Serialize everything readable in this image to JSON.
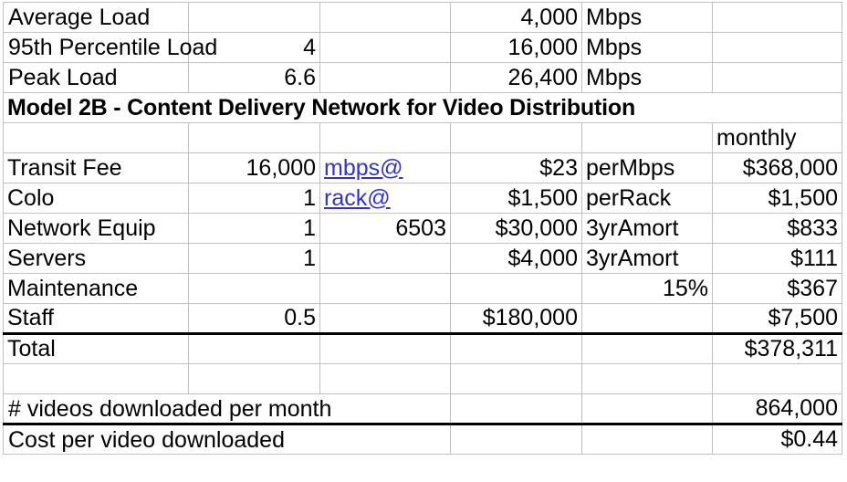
{
  "sheet": {
    "title_row": "Model 2B - Content Delivery Network for Video Distribution",
    "columns": [
      "A",
      "B",
      "C",
      "D",
      "E",
      "F"
    ],
    "rows": [
      {
        "name": "average-load",
        "label": "Average Load",
        "qty": "",
        "unit_link": "",
        "rate": "4,000",
        "basis": "Mbps",
        "monthly": ""
      },
      {
        "name": "95th-percentile-load",
        "label": "95th Percentile Load",
        "qty": "4",
        "unit_link": "",
        "rate": "16,000",
        "basis": "Mbps",
        "monthly": ""
      },
      {
        "name": "peak-load",
        "label": "Peak Load",
        "qty": "6.6",
        "unit_link": "",
        "rate": "26,400",
        "basis": "Mbps",
        "monthly": ""
      },
      {
        "name": "header-monthly",
        "label": "",
        "qty": "",
        "unit_link": "",
        "rate": "",
        "basis": "",
        "monthly": "monthly"
      },
      {
        "name": "transit-fee",
        "label": "Transit Fee",
        "qty": "16,000",
        "unit_link": "mbps@",
        "rate": "$23",
        "basis": "perMbps",
        "monthly": "$368,000"
      },
      {
        "name": "colo",
        "label": "Colo",
        "qty": "1",
        "unit_link": "rack@",
        "rate": "$1,500",
        "basis": "perRack",
        "monthly": "$1,500"
      },
      {
        "name": "network-equip",
        "label": "Network Equip",
        "qty": "1",
        "unit_link": "6503",
        "rate": "$30,000",
        "basis": "3yrAmort",
        "monthly": "$833"
      },
      {
        "name": "servers",
        "label": "Servers",
        "qty": "1",
        "unit_link": "",
        "rate": "$4,000",
        "basis": "3yrAmort",
        "monthly": "$111"
      },
      {
        "name": "maintenance",
        "label": "Maintenance",
        "qty": "",
        "unit_link": "",
        "rate": "",
        "basis": "15%",
        "monthly": "$367"
      },
      {
        "name": "staff",
        "label": "Staff",
        "qty": "0.5",
        "unit_link": "",
        "rate": "$180,000",
        "basis": "",
        "monthly": "$7,500"
      },
      {
        "name": "total",
        "label": "Total",
        "qty": "",
        "unit_link": "",
        "rate": "",
        "basis": "",
        "monthly": "$378,311"
      },
      {
        "name": "blank-spacer",
        "label": "",
        "qty": "",
        "unit_link": "",
        "rate": "",
        "basis": "",
        "monthly": ""
      },
      {
        "name": "videos-downloaded-per-month",
        "label": "# videos downloaded per month",
        "qty": "",
        "unit_link": "",
        "rate": "",
        "basis": "",
        "monthly": "864,000"
      },
      {
        "name": "cost-per-video-downloaded",
        "label": "Cost per video downloaded",
        "qty": "",
        "unit_link": "",
        "rate": "",
        "basis": "",
        "monthly": "$0.44"
      }
    ]
  },
  "style": {
    "gridline_color": "#c0c0c0",
    "link_color": "#3333cc",
    "text_color": "#000000",
    "rule_color": "#000000",
    "background": "#ffffff"
  }
}
